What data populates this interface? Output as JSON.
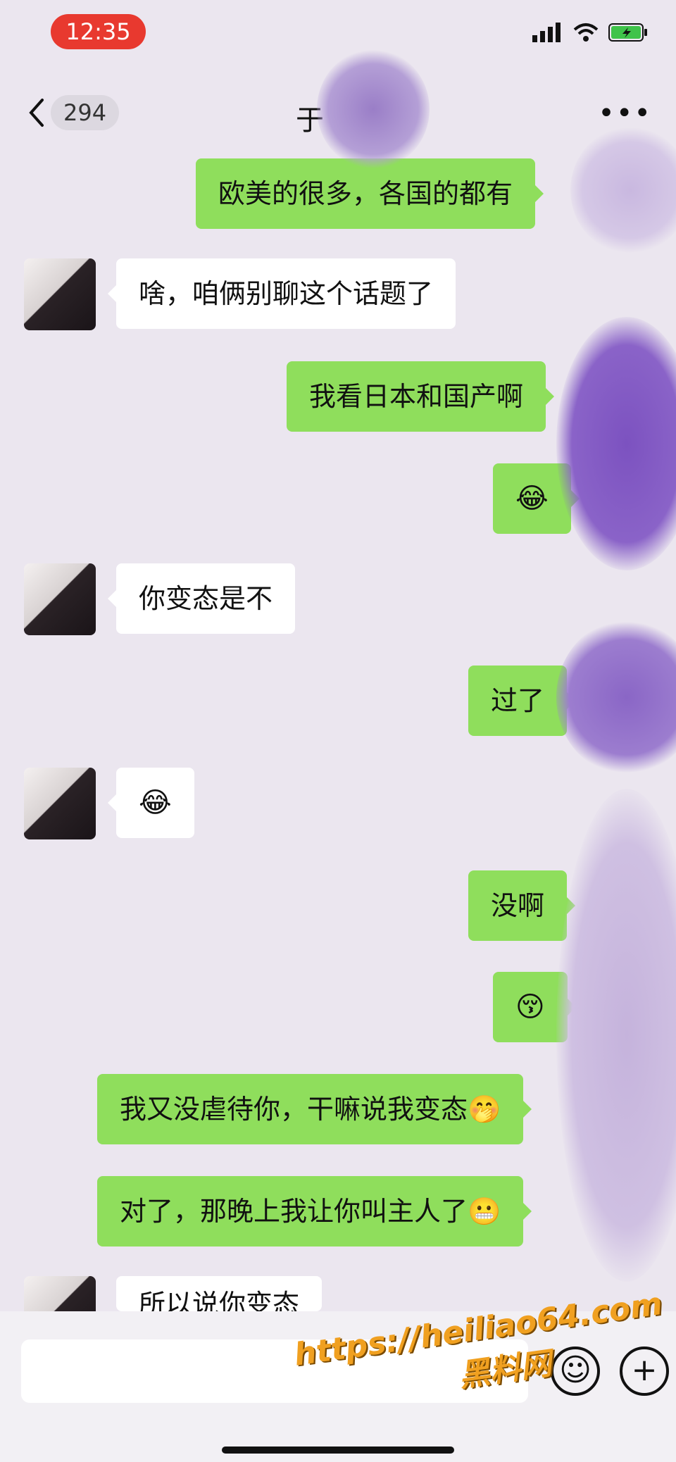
{
  "status": {
    "time": "12:35"
  },
  "nav": {
    "unread_count": "294",
    "title": "于",
    "more": "•••"
  },
  "messages": [
    {
      "side": "sent",
      "text": "欧美的很多，各国的都有"
    },
    {
      "side": "recv",
      "text": "啥，咱俩别聊这个话题了"
    },
    {
      "side": "sent",
      "text": "我看日本和国产啊"
    },
    {
      "side": "sent",
      "text": "😂"
    },
    {
      "side": "recv",
      "text": "你变态是不"
    },
    {
      "side": "sent",
      "text": "过了"
    },
    {
      "side": "recv",
      "text": "😂"
    },
    {
      "side": "sent",
      "text": "没啊"
    },
    {
      "side": "sent",
      "text": "😚"
    },
    {
      "side": "sent",
      "text": "我又没虐待你，干嘛说我变态🤭"
    },
    {
      "side": "sent",
      "text": "对了，那晚上我让你叫主人了😬"
    },
    {
      "side": "recv",
      "text": "所以说你变态"
    }
  ],
  "input": {
    "placeholder": ""
  },
  "watermark": {
    "url": "https://heiliao64.com",
    "name": "黑料网"
  },
  "colors": {
    "sent_bubble": "#8fde5c",
    "recv_bubble": "#ffffff",
    "background": "#ebe6ef",
    "time_pill": "#e8392f"
  },
  "icons": [
    "chevron-left-icon",
    "more-icon",
    "emoji-icon",
    "plus-icon",
    "signal-icon",
    "wifi-icon",
    "battery-icon"
  ]
}
